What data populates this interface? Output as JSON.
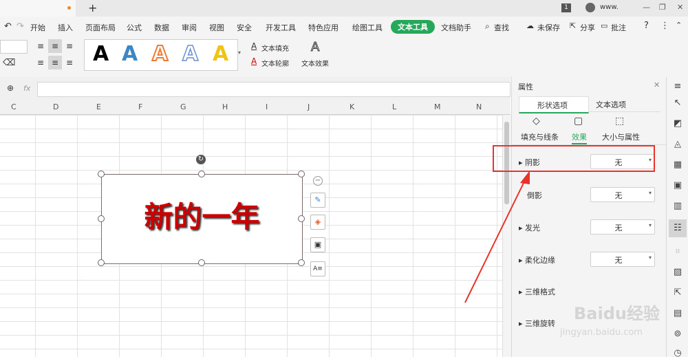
{
  "titlebar": {
    "tab_plus": "+",
    "badge": "1",
    "user": "www.",
    "min": "—",
    "restore": "❐",
    "close": "✕"
  },
  "tabs": [
    "开始",
    "插入",
    "页面布局",
    "公式",
    "数据",
    "审阅",
    "视图",
    "安全",
    "开发工具",
    "特色应用",
    "绘图工具",
    "文本工具",
    "文档助手"
  ],
  "active_tab": "文本工具",
  "quick": {
    "search": "查找",
    "unsaved": "未保存",
    "share": "分享",
    "annotate": "批注",
    "help": "?"
  },
  "toolbar": {
    "text_fill": "文本填充",
    "text_outline": "文本轮廓",
    "text_effect": "文本效果",
    "style_letter": "A"
  },
  "formula": {
    "fx": "fx",
    "value": ""
  },
  "columns": [
    "C",
    "D",
    "E",
    "F",
    "G",
    "H",
    "I",
    "J",
    "K",
    "L",
    "M",
    "N"
  ],
  "textbox": {
    "text": "新的一年"
  },
  "panel": {
    "title": "属性",
    "tabs": [
      "形状选项",
      "文本选项"
    ],
    "subtabs": [
      "填充与线条",
      "效果",
      "大小与属性"
    ],
    "rows": [
      {
        "label": "阴影",
        "value": "无"
      },
      {
        "label": "倒影",
        "value": "无"
      },
      {
        "label": "发光",
        "value": "无"
      },
      {
        "label": "柔化边缘",
        "value": "无"
      },
      {
        "label": "三维格式",
        "value": ""
      },
      {
        "label": "三维旋转",
        "value": ""
      }
    ]
  },
  "watermark": {
    "brand": "Baidu经验",
    "url": "jingyan.baidu.com"
  },
  "colors": {
    "accent": "#26a85a",
    "highlight": "#e8332c",
    "text_red": "#cc0000"
  }
}
